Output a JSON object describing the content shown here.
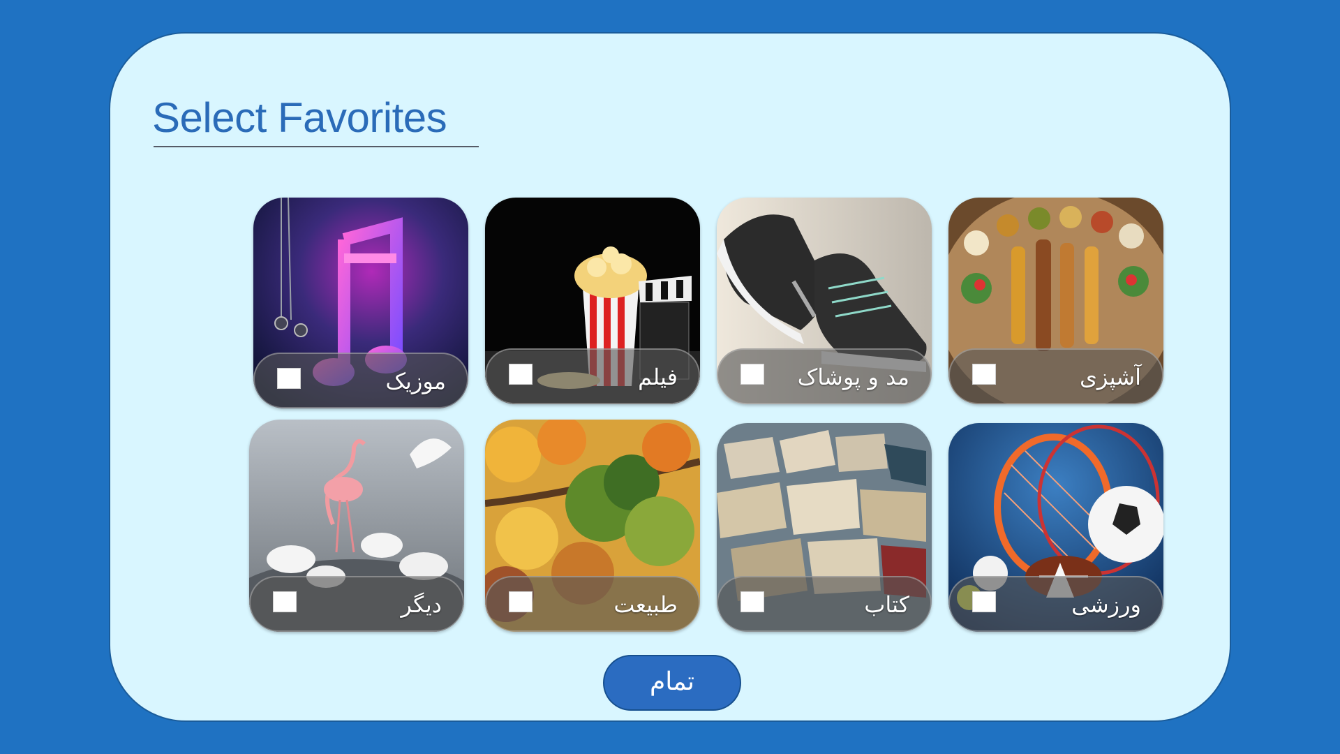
{
  "title": "Select Favorites",
  "cards": [
    {
      "label": "موزیک",
      "icon": "music-note-icon",
      "checked": false
    },
    {
      "label": "فیلم",
      "icon": "popcorn-clapperboard-icon",
      "checked": false
    },
    {
      "label": "مد و پوشاک",
      "icon": "sneaker-icon",
      "checked": false
    },
    {
      "label": "آشپزی",
      "icon": "food-platter-icon",
      "checked": false
    },
    {
      "label": "دیگر",
      "icon": "birds-icon",
      "checked": false
    },
    {
      "label": "طبیعت",
      "icon": "autumn-leaves-icon",
      "checked": false
    },
    {
      "label": "کتاب",
      "icon": "books-icon",
      "checked": false
    },
    {
      "label": "ورزشی",
      "icon": "sports-balls-icon",
      "checked": false
    }
  ],
  "done_button": "تمام",
  "colors": {
    "background": "#1f72c2",
    "panel": "#d9f6ff",
    "accent": "#2b6cc1"
  }
}
